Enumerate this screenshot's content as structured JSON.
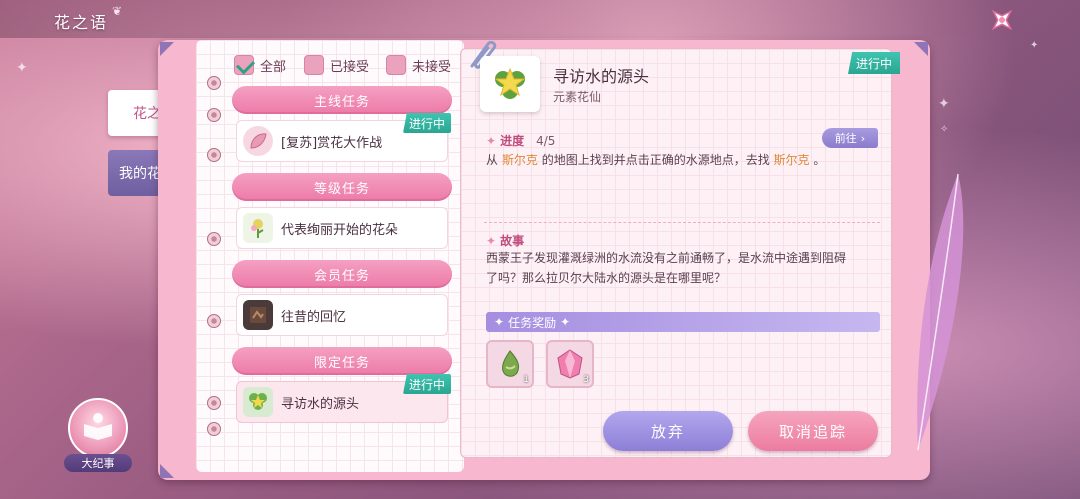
{
  "window": {
    "title": "花之语"
  },
  "side_tabs": [
    {
      "label": "花之语",
      "active": true
    },
    {
      "label": "我的花语录",
      "active": false
    }
  ],
  "filters": [
    {
      "label": "全部",
      "checked": true
    },
    {
      "label": "已接受",
      "checked": false
    },
    {
      "label": "未接受",
      "checked": false
    }
  ],
  "categories": [
    {
      "header": "主线任务",
      "task": {
        "name": "[复苏]赏花大作战",
        "status": "进行中"
      }
    },
    {
      "header": "等级任务",
      "task": {
        "name": "代表绚丽开始的花朵",
        "status": ""
      }
    },
    {
      "header": "会员任务",
      "task": {
        "name": "往昔的回忆",
        "status": ""
      }
    },
    {
      "header": "限定任务",
      "task": {
        "name": "寻访水的源头",
        "status": "进行中"
      }
    }
  ],
  "detail": {
    "title": "寻访水的源头",
    "subtitle": "元素花仙",
    "status": "进行中",
    "progress_label": "进度",
    "progress_value": "4/5",
    "goto_label": "前往",
    "objective": {
      "prefix": "从",
      "place": "斯尔克",
      "middle": "的地图上找到并点击正确的水源地点，去找",
      "npc": "斯尔克",
      "suffix": "。"
    },
    "story_label": "故事",
    "story_line1": "西蒙王子发现灌溉绿洲的水流没有之前通畅了，是水流中途遇到阻碍",
    "story_line2": "了吗？那么拉贝尔大陆水的源头是在哪里呢？",
    "reward_label": "任务奖励",
    "rewards": [
      {
        "icon": "green-seed-icon",
        "count": "1"
      },
      {
        "icon": "pink-crystal-icon",
        "count": "3"
      }
    ]
  },
  "buttons": {
    "abandon": "放弃",
    "untrack": "取消追踪"
  },
  "memoir": {
    "label": "大纪事"
  },
  "colors": {
    "accent_pink": "#ec7aa8",
    "progress_teal": "#2aa692",
    "lavender": "#8d7fd6"
  }
}
